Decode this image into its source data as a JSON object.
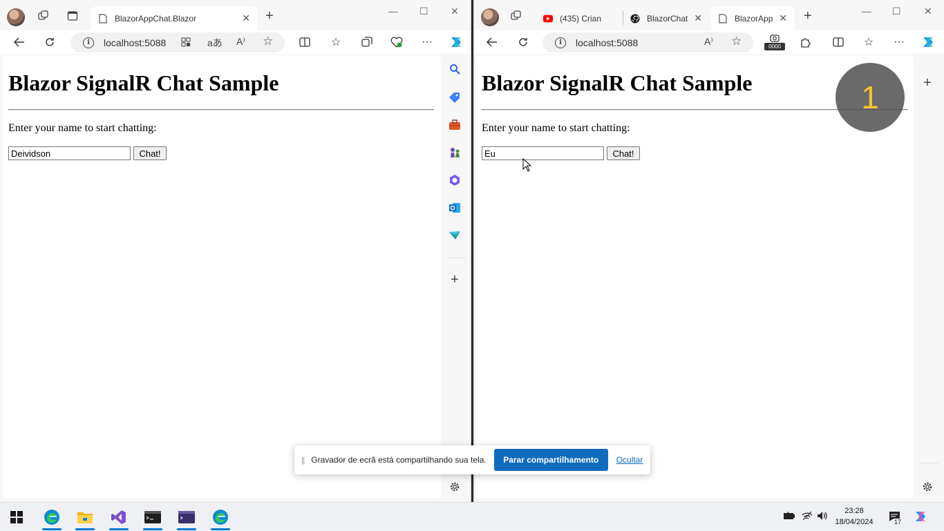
{
  "left_window": {
    "tabs": [
      {
        "title": "BlazorAppChat.Blazor",
        "active": true
      }
    ],
    "url": "localhost:5088",
    "page": {
      "heading": "Blazor SignalR Chat Sample",
      "prompt": "Enter your name to start chatting:",
      "name_value": "Deividson",
      "chat_button": "Chat!"
    }
  },
  "right_window": {
    "tabs": [
      {
        "title": "(435) Crian",
        "active": false
      },
      {
        "title": "BlazorChat",
        "active": false
      },
      {
        "title": "BlazorAppC",
        "active": true
      }
    ],
    "url": "localhost:5088",
    "ext_badge": "0000",
    "page": {
      "heading": "Blazor SignalR Chat Sample",
      "prompt": "Enter your name to start chatting:",
      "name_value": "Eu",
      "chat_button": "Chat!"
    },
    "click_counter": "1"
  },
  "screen_recorder_bar": {
    "message": "Gravador de ecrã está compartilhando sua tela.",
    "stop_button": "Parar compartilhamento",
    "hide_link": "Ocultar"
  },
  "taskbar": {
    "time": "23:28",
    "date": "18/04/2024",
    "notification_count": "17",
    "apps": [
      "start",
      "edge",
      "file-explorer",
      "visual-studio",
      "terminal",
      "vs-debug-console",
      "edge"
    ]
  },
  "colors": {
    "accent": "#0f6cbd",
    "counter_text": "#f4c430",
    "youtube": "#ff0000"
  }
}
